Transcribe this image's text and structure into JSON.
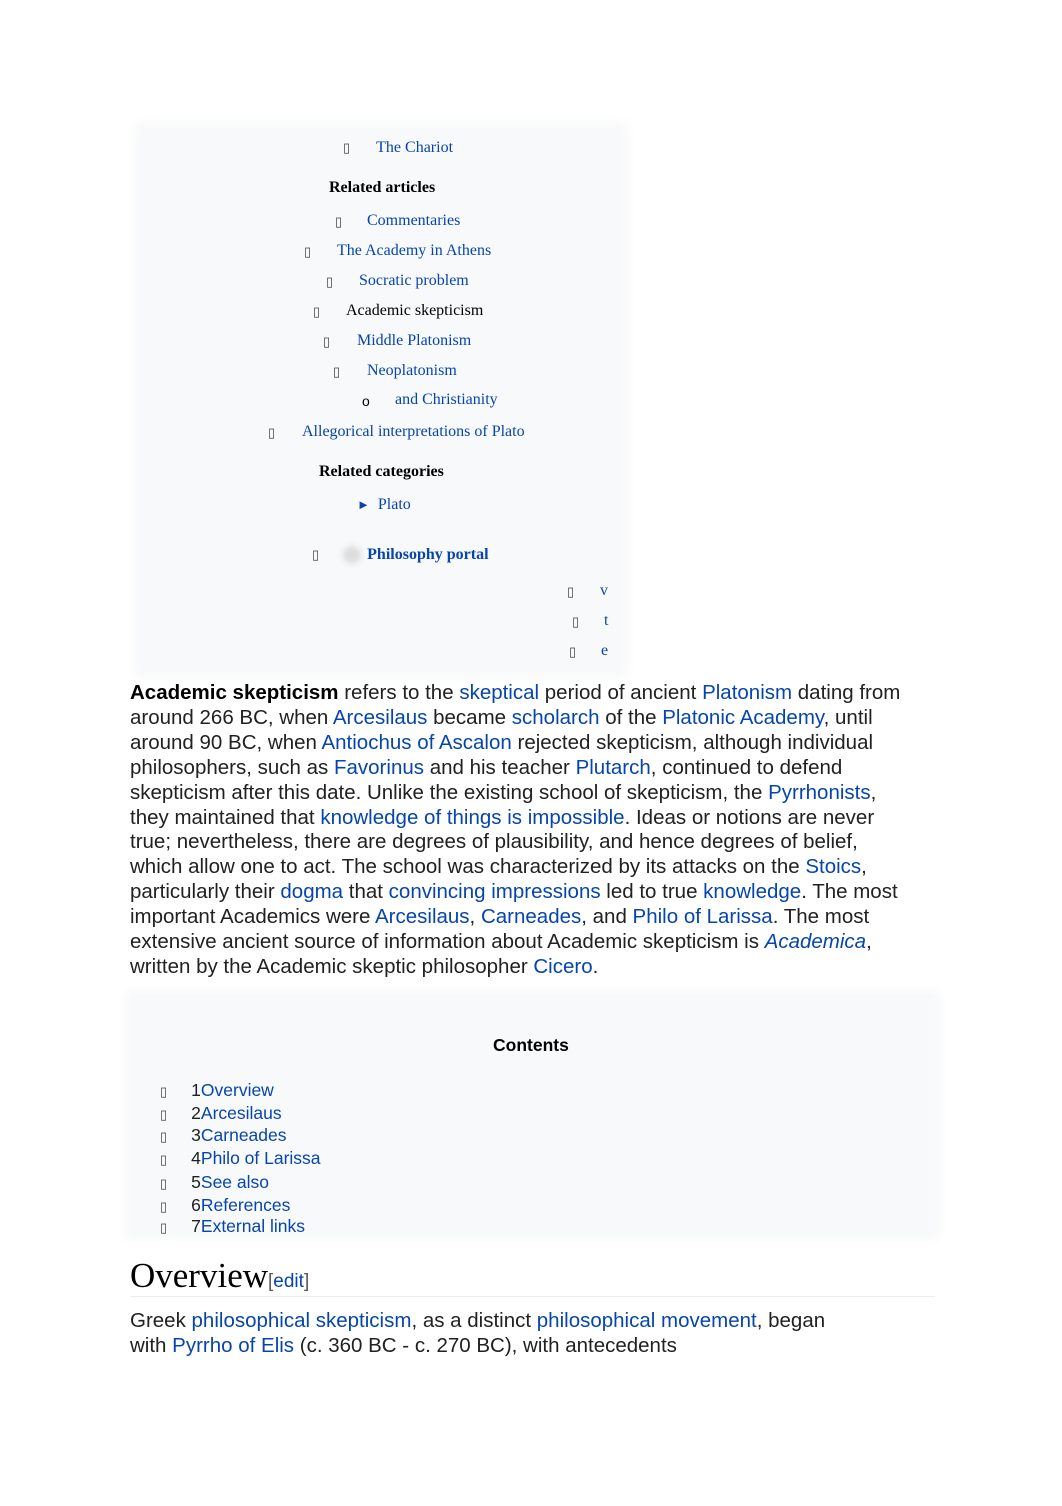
{
  "sidebar": {
    "top_item": {
      "label": "The Chariot"
    },
    "related_articles_heading": "Related articles",
    "articles": [
      {
        "label": "Commentaries",
        "link": true
      },
      {
        "label": "The Academy in Athens",
        "link": true
      },
      {
        "label": "Socratic problem",
        "link": true
      },
      {
        "label": "Academic skepticism",
        "link": false
      },
      {
        "label": "Middle Platonism",
        "link": true
      },
      {
        "label": "Neoplatonism",
        "link": true
      },
      {
        "label": "and Christianity",
        "link": true,
        "sub_bullet": "o"
      },
      {
        "label": "Allegorical interpretations of Plato",
        "link": true
      }
    ],
    "related_categories_heading": "Related categories",
    "category": {
      "arrow": "►",
      "label": "Plato"
    },
    "portal": "Philosophy portal",
    "navbox_links": [
      "v",
      "t",
      "e"
    ]
  },
  "intro_lines": [
    [
      {
        "t": "Academic skepticism",
        "b": true
      },
      {
        "t": " refers to the "
      },
      {
        "t": "skeptical",
        "l": true
      },
      {
        "t": " period of ancient "
      },
      {
        "t": "Platonism",
        "l": true
      },
      {
        "t": " dating from"
      }
    ],
    [
      {
        "t": "around 266 BC, when "
      },
      {
        "t": "Arcesilaus",
        "l": true
      },
      {
        "t": " became "
      },
      {
        "t": "scholarch",
        "l": true
      },
      {
        "t": " of the "
      },
      {
        "t": "Platonic Academy",
        "l": true
      },
      {
        "t": ", until"
      }
    ],
    [
      {
        "t": "around 90 BC, when "
      },
      {
        "t": "Antiochus of Ascalon",
        "l": true
      },
      {
        "t": " rejected skepticism, although individual"
      }
    ],
    [
      {
        "t": "philosophers, such as "
      },
      {
        "t": "Favorinus",
        "l": true
      },
      {
        "t": " and his teacher "
      },
      {
        "t": "Plutarch",
        "l": true
      },
      {
        "t": ", continued to defend"
      }
    ],
    [
      {
        "t": "skepticism after this date. Unlike the existing school of skepticism, the "
      },
      {
        "t": "Pyrrhonists",
        "l": true
      },
      {
        "t": ","
      }
    ],
    [
      {
        "t": "they maintained that "
      },
      {
        "t": "knowledge of things is impossible",
        "l": true
      },
      {
        "t": ". Ideas or notions are never"
      }
    ],
    [
      {
        "t": "true; nevertheless, there are degrees of plausibility, and hence degrees of belief,"
      }
    ],
    [
      {
        "t": "which allow one to act. The school was characterized by its attacks on the "
      },
      {
        "t": "Stoics",
        "l": true
      },
      {
        "t": ","
      }
    ],
    [
      {
        "t": "particularly their "
      },
      {
        "t": "dogma",
        "l": true
      },
      {
        "t": " that "
      },
      {
        "t": "convincing impressions",
        "l": true
      },
      {
        "t": " led to true "
      },
      {
        "t": "knowledge",
        "l": true
      },
      {
        "t": ". The most"
      }
    ],
    [
      {
        "t": "important Academics were "
      },
      {
        "t": "Arcesilaus",
        "l": true
      },
      {
        "t": ", "
      },
      {
        "t": "Carneades",
        "l": true
      },
      {
        "t": ", and "
      },
      {
        "t": "Philo of Larissa",
        "l": true
      },
      {
        "t": ". The most"
      }
    ],
    [
      {
        "t": "extensive ancient source of information about Academic skepticism is "
      },
      {
        "t": "Academica",
        "l": true,
        "i": true
      },
      {
        "t": ","
      }
    ],
    [
      {
        "t": "written by the Academic skeptic philosopher "
      },
      {
        "t": "Cicero",
        "l": true
      },
      {
        "t": "."
      }
    ]
  ],
  "toc": {
    "title": "Contents",
    "items": [
      {
        "num": "1",
        "label": "Overview"
      },
      {
        "num": "2",
        "label": "Arcesilaus"
      },
      {
        "num": "3",
        "label": "Carneades"
      },
      {
        "num": "4",
        "label": "Philo of Larissa"
      },
      {
        "num": "5",
        "label": "See also"
      },
      {
        "num": "6",
        "label": "References"
      },
      {
        "num": "7",
        "label": "External links"
      }
    ]
  },
  "overview": {
    "heading": "Overview",
    "edit_open": "[",
    "edit_label": "edit",
    "edit_close": "]",
    "lines": [
      [
        {
          "t": "Greek "
        },
        {
          "t": "philosophical skepticism",
          "l": true
        },
        {
          "t": ", as a distinct "
        },
        {
          "t": "philosophical movement",
          "l": true
        },
        {
          "t": ", began"
        }
      ],
      [
        {
          "t": "with "
        },
        {
          "t": "Pyrrho of Elis",
          "l": true
        },
        {
          "t": " (c. 360 BC - c. 270 BC), with antecedents"
        }
      ]
    ]
  },
  "bullet_glyph": "▯"
}
